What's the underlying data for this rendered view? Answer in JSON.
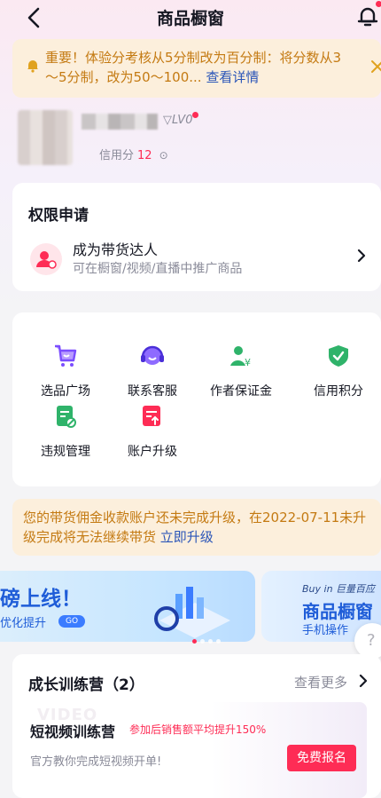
{
  "header": {
    "title": "商品橱窗"
  },
  "notice": {
    "text": "重要！体验分考核从5分制改为百分制：将分数从3～5分制，改为50～100...",
    "link": "查看详情"
  },
  "profile": {
    "level": "LV0",
    "credit_label": "信用分",
    "credit_value": "12"
  },
  "permission": {
    "title": "权限申请",
    "item_title": "成为带货达人",
    "item_desc": "可在橱窗/视频/直播中推广商品"
  },
  "tools": [
    {
      "label": "选品广场",
      "icon": "cart-icon",
      "color": "#7b4dff"
    },
    {
      "label": "联系客服",
      "icon": "headset-icon",
      "color": "#6a4dff"
    },
    {
      "label": "作者保证金",
      "icon": "deposit-icon",
      "color": "#2fb36a"
    },
    {
      "label": "信用积分",
      "icon": "shield-check-icon",
      "color": "#2fb36a"
    },
    {
      "label": "违规管理",
      "icon": "violation-icon",
      "color": "#2fb36a"
    },
    {
      "label": "账户升级",
      "icon": "upgrade-icon",
      "color": "#fe2c55"
    }
  ],
  "warning": {
    "text": "您的带货佣金收款账户还未完成升级，在2022-07-11未升级完成将无法继续带货",
    "link": "立即升级"
  },
  "banners": {
    "b1_big": "磅上线！",
    "b1_small": "优化提升",
    "b1_go": "GO",
    "b2_top": "Buy in 巨量百应",
    "b2_title": "商品橱窗",
    "b2_sub": "手机操作"
  },
  "help": {
    "label": "?"
  },
  "camp": {
    "title": "成长训练营（2）",
    "more": "查看更多",
    "watermark": "VIDEO",
    "card_title": "短视频训练营",
    "card_tag": "参加后销售额平均提升150%",
    "card_desc": "官方教你完成短视频开单!",
    "card_button": "免费报名"
  },
  "colors": {
    "accent": "#fe2c55",
    "warn_text": "#c47a12",
    "link": "#2a55b8"
  }
}
